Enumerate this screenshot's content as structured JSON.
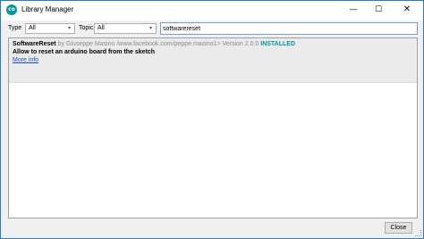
{
  "window": {
    "title": "Library Manager",
    "icon": "arduino-icon",
    "icon_text": "co",
    "controls": {
      "minimize": "—",
      "maximize": "☐",
      "close": "✕"
    }
  },
  "filters": {
    "type_label": "Type",
    "type_value": "All",
    "topic_label": "Topic",
    "topic_value": "All"
  },
  "search": {
    "value": "softwarereset"
  },
  "libraries": [
    {
      "name": "SoftwareReset",
      "author": " by Giuseppe Masino /www.facebook.com/peppe.masino1> Version 2.0.0 ",
      "status": "INSTALLED",
      "description": "Allow to reset an arduino board from the sketch",
      "link": "More info"
    }
  ],
  "footer": {
    "close_label": "Close"
  },
  "colors": {
    "accent": "#00979c",
    "link": "#1a4fb8",
    "selected_row": "#ebebeb"
  }
}
